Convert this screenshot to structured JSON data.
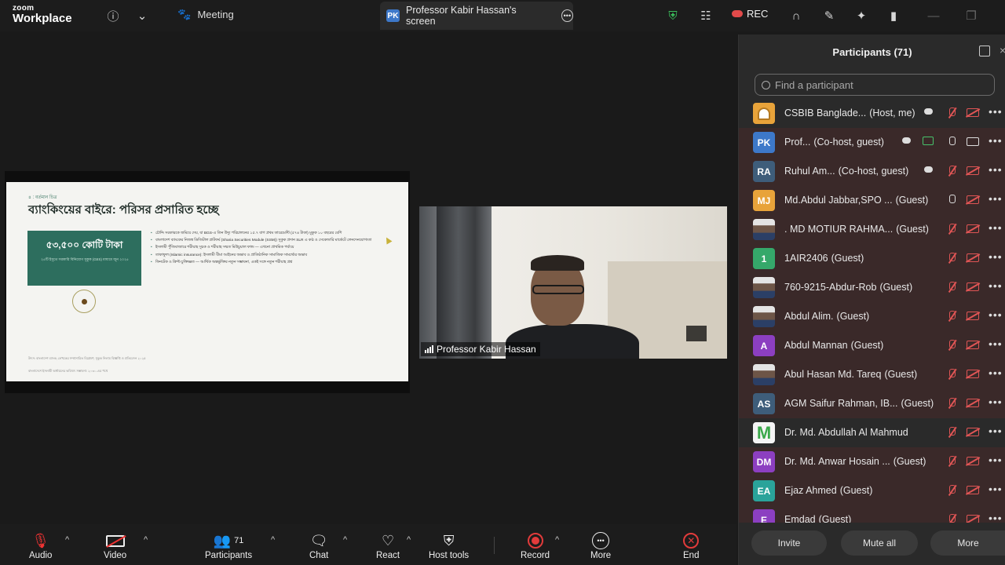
{
  "app": {
    "logo_small": "zoom",
    "logo_big": "Workplace"
  },
  "topbar": {
    "meeting_label": "Meeting",
    "screen_badge": "PK",
    "screen_tab": "Professor Kabir Hassan's screen",
    "rec_label": "REC"
  },
  "slide": {
    "tag": "৪ : বর্তমান চিত্র",
    "title": "ব্যাংকিংয়ের বাইরে: পরিসর প্রসারিত হচ্ছে",
    "box_big": "৫৩,৫০০ কোটি টাকা",
    "box_small": "২৫টি ইসুতে সরকারি বিনিয়োগ সুকুক (GIIS) মাধ্যমে জুন ২০২৫",
    "bullets": [
      "চৌদ্দি সরকারকে জমিয়ে দেয়, যা BGS-এ তিন উদ্যু পরিচালনের ১৫.৭ বাগ প্রথম তারেমেন্টি (৫৭৪ টাকা) মুকুক ১০ বছরের বেশি",
      "বাংলাদেশ ব্যাংকের নিজস্ব ডিজিটাল প্লাটফর্ম (Sharia Securities Module (SSM)) সুকুক প্রদান SLR এ কণ্ঠ ও সেকেন্ডারি মার্কেটে লেনদেনযোগ্যতা",
      "ইসলামী পুঁজিবাজারে শরীয়াহ সুচক ও শরীয়াহ সম্মত মিউচুয়াল ফান্ড — এখনো প্রাথমিক পর্যায়ে",
      "তাকাফুল (Islamic insurance): ইসলামী বীমা আইনের অভাব ও প্রাতিষ্ঠানিক সামাজিক সামর্থ্যের অভাব",
      "ফিনটেক ও ক্রিপ্ট চুক্তিজ্ঞত — আর্থিক অন্তর্ভুক্তির নতুন সম্ভাবনা, একই সঙ্গে নতুন শরীয়াহ প্রশ্ন"
    ],
    "foot1": "উৎস: বাংলাদেশ ব্যাংক; লেখকের সম্প্রসারিত বিশ্লেষণ; সুকুক নিলাম বিজ্ঞপ্তি ও প্রতিবেদন ২০২৫",
    "foot2": "বাংলাদেশে ইসলামী অর্থায়নের ভবিষ্যৎ সম্ভাবনা: ২০৩০-এর পথে"
  },
  "video": {
    "name": "Professor Kabir Hassan"
  },
  "panel": {
    "title": "Participants (71)",
    "search_placeholder": "Find a participant",
    "participants": [
      {
        "initials": "",
        "color": "#e8a33a",
        "name": "CSBIB Banglade...",
        "role": "(Host, me)",
        "mic": "off",
        "cam": "off",
        "cloud": true,
        "bg": "dark"
      },
      {
        "initials": "PK",
        "color": "#3d78c9",
        "name": "Prof...",
        "role": "(Co-host, guest)",
        "mic": "on",
        "cam": "on",
        "cloud": true,
        "share": true,
        "bg": "red"
      },
      {
        "initials": "RA",
        "color": "#3e5d7a",
        "name": "Ruhul Am...",
        "role": "(Co-host, guest)",
        "mic": "off",
        "cam": "off",
        "cloud": true,
        "bg": "red"
      },
      {
        "initials": "MJ",
        "color": "#e8a33a",
        "name": "Md.Abdul Jabbar,SPO ...",
        "role": "(Guest)",
        "mic": "on",
        "cam": "off",
        "bg": "red"
      },
      {
        "initials": "",
        "color": "photo",
        "name": ". MD MOTIUR RAHMA...",
        "role": "(Guest)",
        "mic": "off",
        "cam": "off",
        "bg": "red"
      },
      {
        "initials": "1",
        "color": "#35a86a",
        "name": "1AIR2406",
        "role": "(Guest)",
        "mic": "off",
        "cam": "off",
        "bg": "red"
      },
      {
        "initials": "",
        "color": "photo",
        "name": "760-9215-Abdur-Rob",
        "role": "(Guest)",
        "mic": "off",
        "cam": "off",
        "bg": "red"
      },
      {
        "initials": "",
        "color": "photo",
        "name": "Abdul Alim.",
        "role": "(Guest)",
        "mic": "off",
        "cam": "off",
        "bg": "red"
      },
      {
        "initials": "A",
        "color": "#8c3fc1",
        "name": "Abdul Mannan",
        "role": "(Guest)",
        "mic": "off",
        "cam": "off",
        "bg": "red"
      },
      {
        "initials": "",
        "color": "photo",
        "name": "Abul Hasan Md. Tareq",
        "role": "(Guest)",
        "mic": "off",
        "cam": "off",
        "bg": "red"
      },
      {
        "initials": "AS",
        "color": "#3e5d7a",
        "name": "AGM Saifur Rahman, IB...",
        "role": "(Guest)",
        "mic": "off",
        "cam": "off",
        "bg": "red"
      },
      {
        "initials": "M",
        "color": "#f4f4f4",
        "name": "Dr. Md. Abdullah Al Mahmud",
        "role": "",
        "mic": "off",
        "cam": "off",
        "bg": "dark",
        "letter_color": "#3aa84a"
      },
      {
        "initials": "DM",
        "color": "#8c3fc1",
        "name": "Dr. Md. Anwar Hosain ...",
        "role": "(Guest)",
        "mic": "off",
        "cam": "off",
        "bg": "red"
      },
      {
        "initials": "EA",
        "color": "#2aa39a",
        "name": "Ejaz Ahmed",
        "role": "(Guest)",
        "mic": "off",
        "cam": "off",
        "bg": "red"
      },
      {
        "initials": "E",
        "color": "#8c3fc1",
        "name": "Emdad",
        "role": "(Guest)",
        "mic": "off",
        "cam": "off",
        "bg": "red"
      }
    ],
    "buttons": {
      "invite": "Invite",
      "mute_all": "Mute all",
      "more": "More"
    }
  },
  "toolbar": {
    "audio": "Audio",
    "video": "Video",
    "participants": "Participants",
    "participants_count": "71",
    "chat": "Chat",
    "react": "React",
    "host_tools": "Host tools",
    "record": "Record",
    "more": "More",
    "end": "End"
  }
}
